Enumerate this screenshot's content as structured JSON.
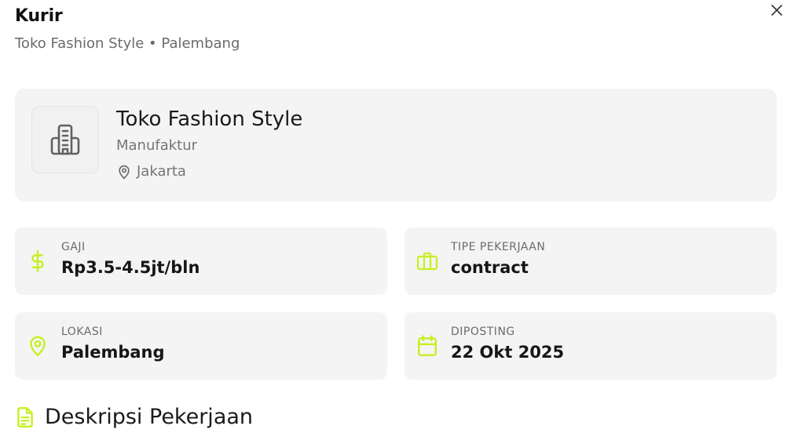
{
  "header": {
    "title": "Kurir",
    "subtitle": "Toko Fashion Style • Palembang",
    "close_icon": "close-icon"
  },
  "company": {
    "name": "Toko Fashion Style",
    "industry": "Manufaktur",
    "location": "Jakarta",
    "logo_icon": "building-icon",
    "location_icon": "map-pin-icon"
  },
  "details": {
    "salary": {
      "label": "GAJI",
      "value": "Rp3.5-4.5jt/bln",
      "icon": "dollar-icon"
    },
    "job_type": {
      "label": "TIPE PEKERJAAN",
      "value": "contract",
      "icon": "briefcase-icon"
    },
    "location": {
      "label": "LOKASI",
      "value": "Palembang",
      "icon": "map-pin-icon"
    },
    "posted": {
      "label": "DIPOSTING",
      "value": "22 Okt 2025",
      "icon": "calendar-icon"
    }
  },
  "description": {
    "title": "Deskripsi Pekerjaan",
    "icon": "document-icon"
  },
  "colors": {
    "accent": "#c6f01e",
    "card_bg": "#f4f4f4",
    "muted_text": "#6b6b6b"
  }
}
